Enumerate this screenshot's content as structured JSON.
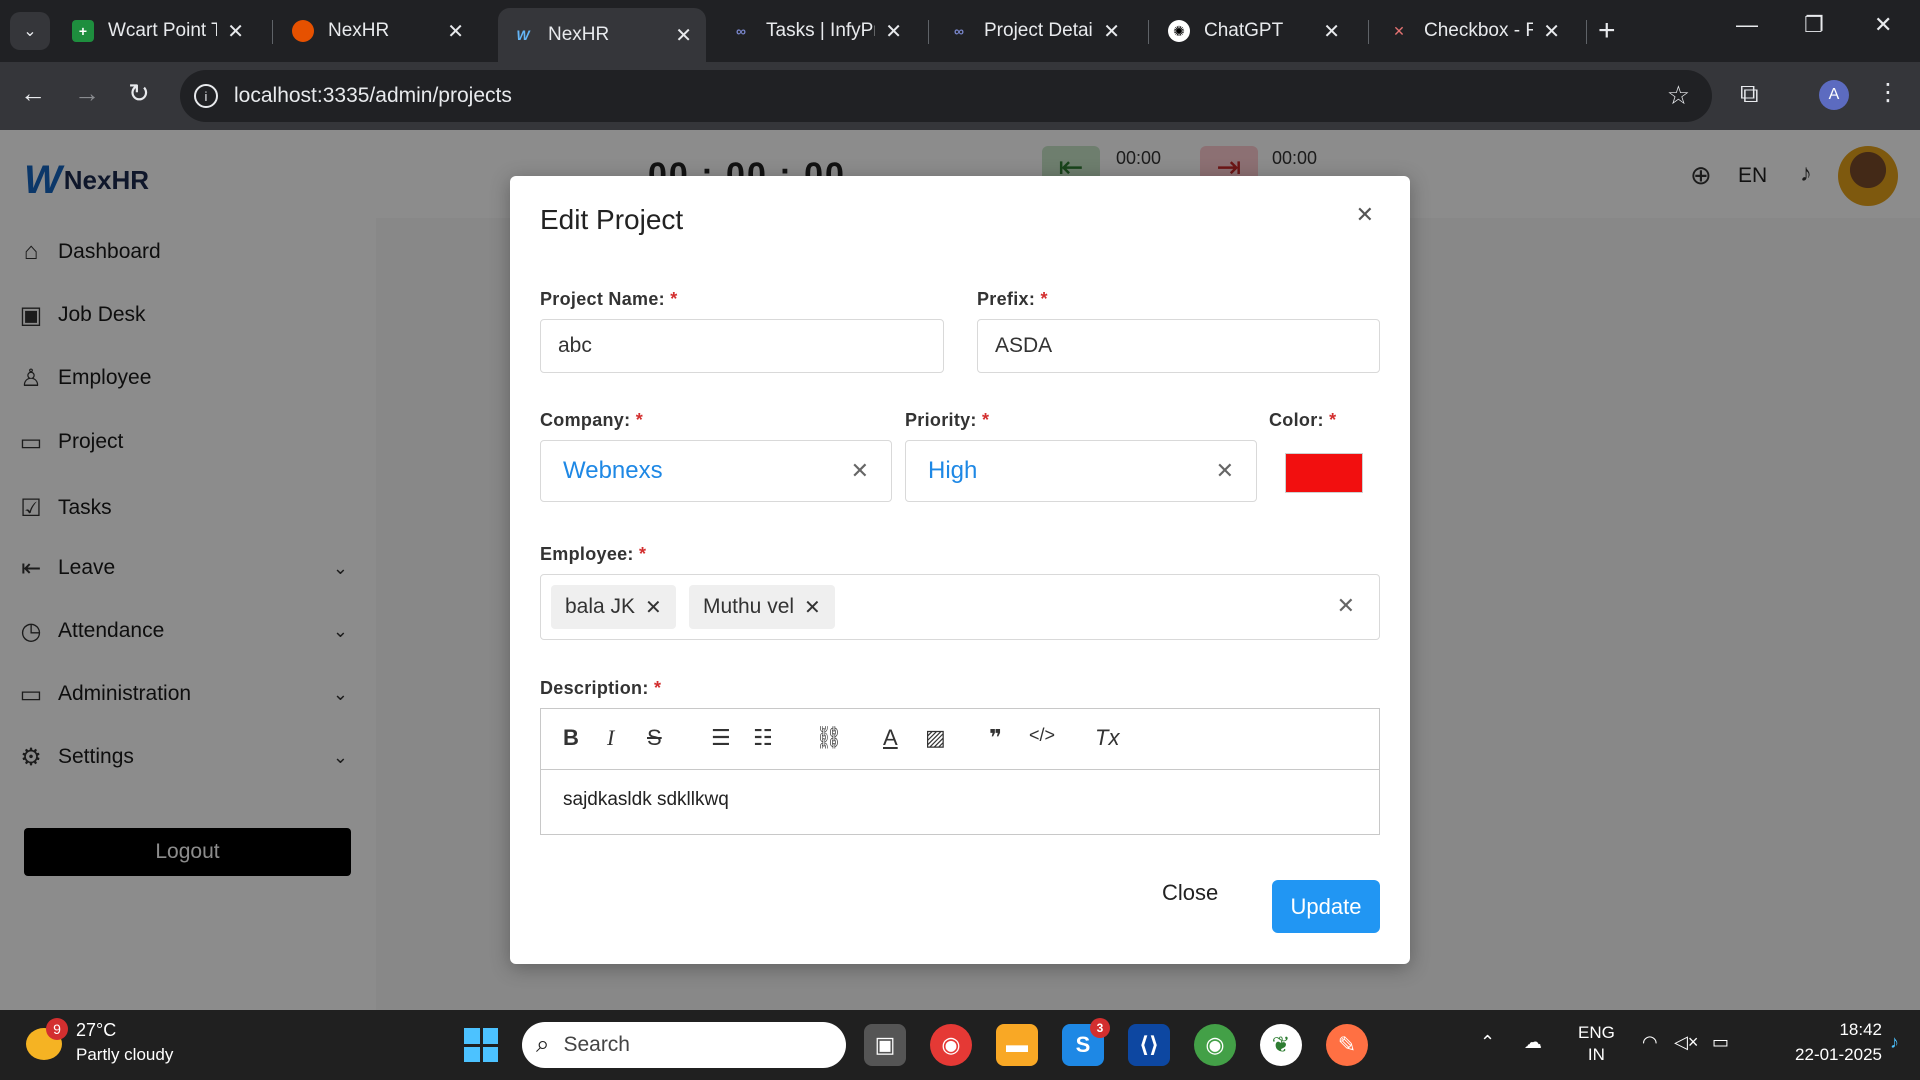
{
  "browser": {
    "tabs": [
      {
        "title": "Wcart Point Tr",
        "active": false
      },
      {
        "title": "NexHR",
        "active": false
      },
      {
        "title": "NexHR",
        "active": true
      },
      {
        "title": "Tasks | InfyPro",
        "active": false
      },
      {
        "title": "Project Details",
        "active": false
      },
      {
        "title": "ChatGPT",
        "active": false
      },
      {
        "title": "Checkbox - Re",
        "active": false
      }
    ],
    "url": "localhost:3335/admin/projects",
    "profile_initial": "A"
  },
  "header": {
    "brand_logo": "W",
    "brand_name": "NexHR",
    "timer": "00 : 00 : 00",
    "punch_in_time": "00:00",
    "punch_out_time": "00:00",
    "language": "EN"
  },
  "sidebar": {
    "items": [
      {
        "label": "Dashboard",
        "icon": "home-icon",
        "expandable": false
      },
      {
        "label": "Job Desk",
        "icon": "briefcase-icon",
        "expandable": false
      },
      {
        "label": "Employee",
        "icon": "user-icon",
        "expandable": false
      },
      {
        "label": "Project",
        "icon": "folder-icon",
        "expandable": false
      },
      {
        "label": "Tasks",
        "icon": "checkbox-icon",
        "expandable": false
      },
      {
        "label": "Leave",
        "icon": "arrow-left-bar-icon",
        "expandable": true
      },
      {
        "label": "Attendance",
        "icon": "clock-icon",
        "expandable": true
      },
      {
        "label": "Administration",
        "icon": "folder-icon",
        "expandable": true
      },
      {
        "label": "Settings",
        "icon": "gear-icon",
        "expandable": true
      }
    ],
    "logout_label": "Logout"
  },
  "modal": {
    "title": "Edit Project",
    "project_name": {
      "label": "Project Name:",
      "required_mark": "*",
      "value": "abc"
    },
    "prefix": {
      "label": "Prefix:",
      "required_mark": "*",
      "value": "ASDA"
    },
    "company": {
      "label": "Company:",
      "required_mark": "*",
      "value": "Webnexs"
    },
    "priority": {
      "label": "Priority:",
      "required_mark": "*",
      "value": "High"
    },
    "color": {
      "label": "Color:",
      "required_mark": "*",
      "value": "#f20f0f"
    },
    "employee": {
      "label": "Employee:",
      "required_mark": "*",
      "chips": [
        "bala JK",
        "Muthu vel"
      ]
    },
    "description": {
      "label": "Description:",
      "required_mark": "*",
      "text": "sajdkasldk sdkllkwq"
    },
    "close_label": "Close",
    "update_label": "Update"
  },
  "taskbar": {
    "weather_temp": "27°C",
    "weather_desc": "Partly cloudy",
    "weather_badge": "9",
    "search_placeholder": "Search",
    "skype_badge": "3",
    "lang_top": "ENG",
    "lang_bottom": "IN",
    "time": "18:42",
    "date": "22-01-2025"
  },
  "colors": {
    "accent": "#2196f3",
    "select_value": "#1e88e5",
    "required": "#d32f2f",
    "logout_bg": "#000000"
  }
}
